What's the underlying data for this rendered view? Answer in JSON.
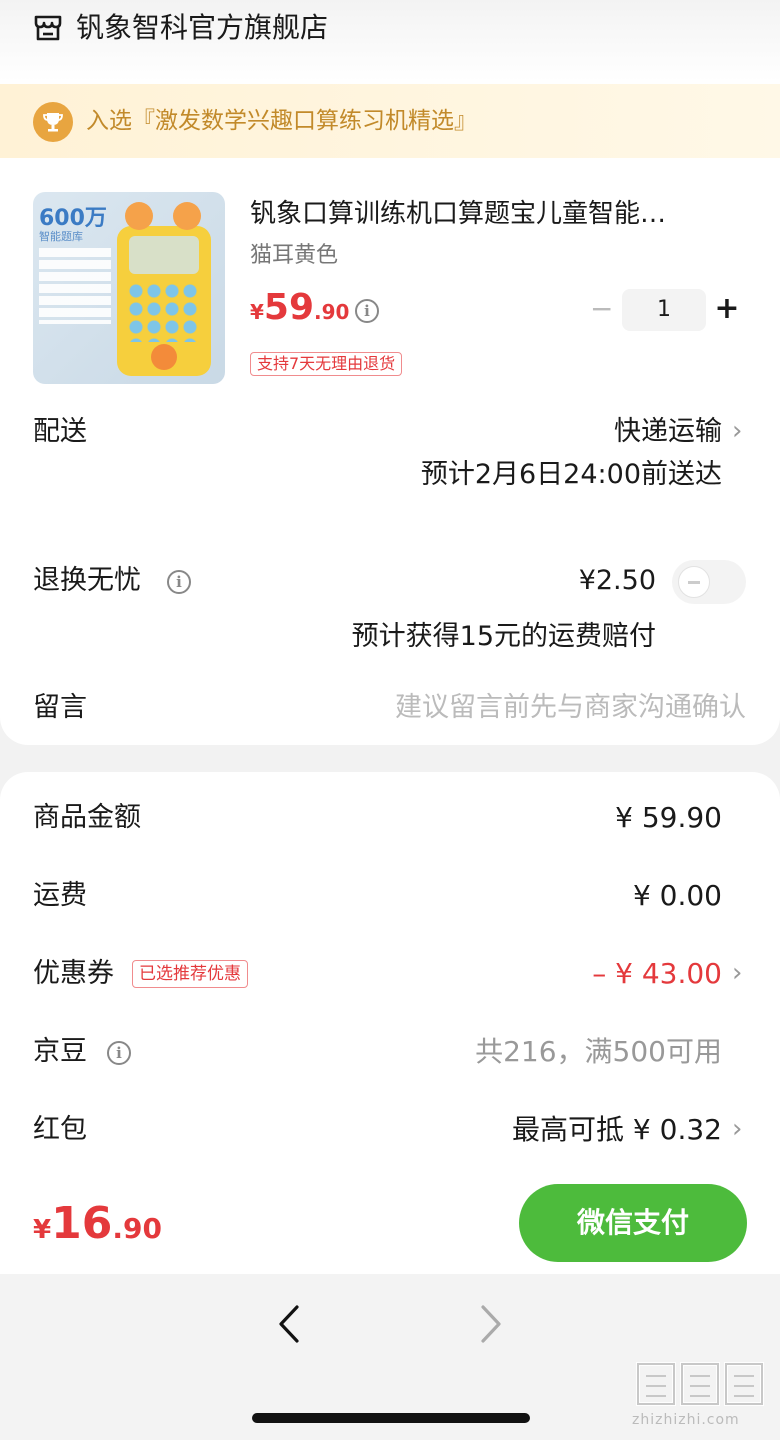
{
  "store": {
    "name": "钒象智科官方旗舰店",
    "icon": "store-icon"
  },
  "promo": {
    "text": "入选『激发数学兴趣口算练习机精选』",
    "icon": "trophy-icon"
  },
  "product": {
    "image_text_1": "600万",
    "image_text_2": "智能题库",
    "title": "钒象口算训练机口算题宝儿童智能…",
    "variant": "猫耳黄色",
    "price_symbol": "¥",
    "price_int": "59",
    "price_dec": ".90",
    "return_badge": "支持7天无理由退货",
    "quantity": "1",
    "minus": "−",
    "plus": "+"
  },
  "delivery": {
    "label": "配送",
    "method": "快递运输",
    "eta": "预计2月6日24:00前送达"
  },
  "return_insurance": {
    "label": "退换无忧",
    "price": "¥2.50",
    "note": "预计获得15元的运费赔付",
    "enabled": false
  },
  "message": {
    "label": "留言",
    "placeholder": "建议留言前先与商家沟通确认"
  },
  "summary": {
    "goods_label": "商品金额",
    "goods_value": "¥ 59.90",
    "shipping_label": "运费",
    "shipping_value": "¥ 0.00",
    "coupon_label": "优惠券",
    "coupon_tag": "已选推荐优惠",
    "coupon_value": "– ¥ 43.00",
    "beans_label": "京豆",
    "beans_value": "共216，满500可用",
    "redpacket_label": "红包",
    "redpacket_value": "最高可抵 ¥ 0.32"
  },
  "pay": {
    "total_symbol": "¥",
    "total_int": "16",
    "total_dec": ".90",
    "button": "微信支付"
  },
  "watermark": {
    "text": "zhizhizhi.com"
  },
  "colors": {
    "price_red": "#e4393c",
    "pay_green": "#4dbb3c",
    "promo_gold": "#c28a2a"
  }
}
